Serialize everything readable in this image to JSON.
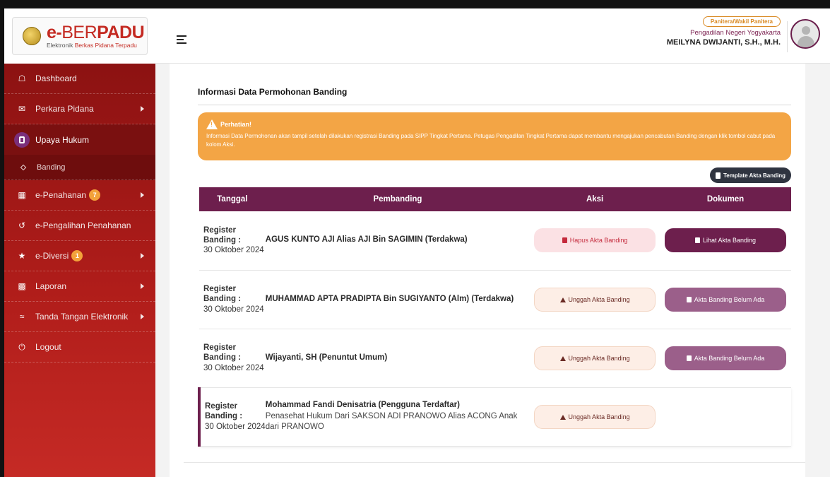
{
  "brand": {
    "title_prefix": "e-",
    "title_thin": "BER",
    "title_bold": "PADU",
    "subtitle_main": "Elektronik ",
    "subtitle_red": "Berkas Pidana Terpadu"
  },
  "user": {
    "role": "Panitera/Wakil Panitera",
    "court": "Pengadilan Negeri Yogyakarta",
    "name": "MEILYNA DWIJANTI, S.H., M.H."
  },
  "sidebar": {
    "items": [
      {
        "label": "Dashboard",
        "icon": "home-icon"
      },
      {
        "label": "Perkara Pidana",
        "icon": "inbox-icon"
      },
      {
        "label": "Upaya Hukum",
        "icon": "document-icon"
      },
      {
        "label": "Banding",
        "icon": "diamond-icon"
      },
      {
        "label": "e-Penahanan",
        "icon": "grid-icon",
        "badge": "7"
      },
      {
        "label": "e-Pengalihan Penahanan",
        "icon": "history-icon"
      },
      {
        "label": "e-Diversi",
        "icon": "star-icon",
        "badge": "1"
      },
      {
        "label": "Laporan",
        "icon": "chart-icon"
      },
      {
        "label": "Tanda Tangan Elektronik",
        "icon": "signature-icon"
      },
      {
        "label": "Logout",
        "icon": "power-icon"
      }
    ]
  },
  "main": {
    "title": "Informasi Data Permohonan Banding",
    "alert_title": "Perhatian!",
    "alert_text": "Informasi Data Permohonan akan tampil setelah dilakukan registrasi Banding pada SIPP Tingkat Pertama. Petugas Pengadilan Tingkat Pertama dapat membantu mengajukan pencabutan Banding dengan klik tombol cabut pada kolom Aksi.",
    "template_button": "Template Akta Banding",
    "columns": [
      "Tanggal",
      "Pembanding",
      "Aksi",
      "Dokumen"
    ],
    "rows": [
      {
        "date_label": "Register Banding :",
        "date": "30 Oktober 2024",
        "pembanding": "AGUS KUNTO AJI Alias AJI Bin SAGIMIN (Terdakwa)",
        "sub": "",
        "action": "Hapus Akta Banding",
        "doc": "Lihat Akta Banding"
      },
      {
        "date_label": "Register Banding :",
        "date": "30 Oktober 2024",
        "pembanding": "MUHAMMAD APTA PRADIPTA Bin SUGIYANTO (Alm) (Terdakwa)",
        "sub": "",
        "action": "Unggah Akta Banding",
        "doc": "Akta Banding Belum Ada"
      },
      {
        "date_label": "Register Banding :",
        "date": "30 Oktober 2024",
        "pembanding": "Wijayanti, SH (Penuntut Umum)",
        "sub": "",
        "action": "Unggah Akta Banding",
        "doc": "Akta Banding Belum Ada"
      },
      {
        "date_label": "Register Banding :",
        "date": "30 Oktober 2024",
        "pembanding": "Mohammad Fandi Denisatria (Pengguna Terdaftar)",
        "sub": "Penasehat Hukum Dari SAKSON ADI PRANOWO Alias ACONG Anak dari PRANOWO",
        "action": "Unggah Akta Banding",
        "doc": ""
      }
    ]
  },
  "colors": {
    "sidebar": "#b01d1a",
    "accent": "#6d1f4d",
    "alert": "#f3a545"
  }
}
